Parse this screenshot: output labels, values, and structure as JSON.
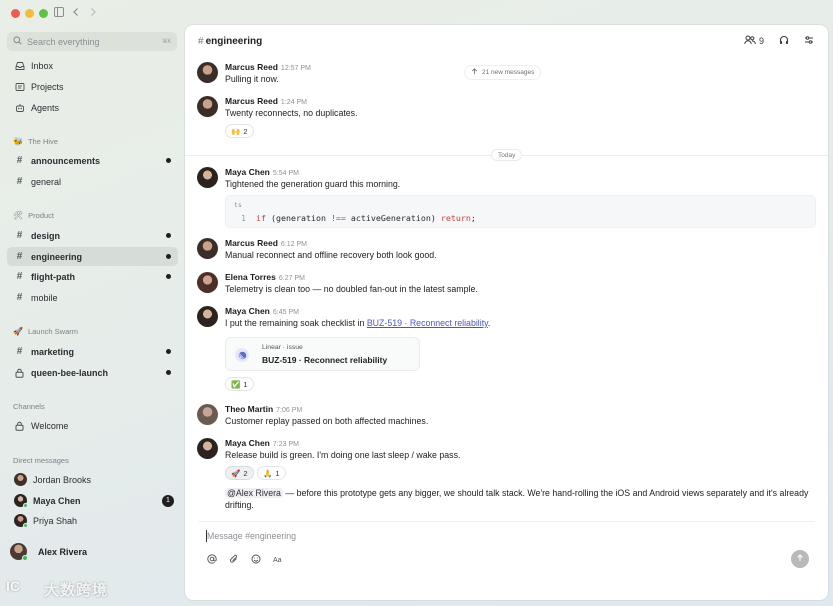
{
  "sidebar": {
    "search_placeholder": "Search everything",
    "search_shortcut": "⌘K",
    "top_items": [
      {
        "label": "Inbox",
        "icon": "inbox-icon"
      },
      {
        "label": "Projects",
        "icon": "projects-icon"
      },
      {
        "label": "Agents",
        "icon": "agents-icon"
      }
    ],
    "sections": [
      {
        "title": "The Hive",
        "emoji": "🐝",
        "channels": [
          {
            "label": "announcements",
            "unread": true
          },
          {
            "label": "general",
            "unread": false
          }
        ]
      },
      {
        "title": "Product",
        "emoji": "🛠",
        "channels": [
          {
            "label": "design",
            "unread": true
          },
          {
            "label": "engineering",
            "unread": true,
            "active": true
          },
          {
            "label": "flight-path",
            "unread": true
          },
          {
            "label": "mobile",
            "unread": false
          }
        ]
      },
      {
        "title": "Launch Swarm",
        "emoji": "🚀",
        "channels": [
          {
            "label": "marketing",
            "unread": true
          },
          {
            "label": "queen-bee-launch",
            "unread": true,
            "locked": true
          }
        ]
      }
    ],
    "channels_title": "Channels",
    "welcome_label": "Welcome",
    "dm_title": "Direct messages",
    "dms": [
      {
        "name": "Jordan Brooks",
        "online": false,
        "unread_count": null
      },
      {
        "name": "Maya Chen",
        "online": true,
        "unread_count": "1"
      },
      {
        "name": "Priya Shah",
        "online": true,
        "unread_count": null
      }
    ],
    "current_user": {
      "name": "Alex Rivera"
    }
  },
  "watermark": "大数跨境",
  "channel": {
    "name": "engineering",
    "member_count": "9",
    "new_messages_label": "21 new messages",
    "day_divider": "Today"
  },
  "messages": [
    {
      "author": "Marcus Reed",
      "time": "12:57 PM",
      "text": "Pulling it now."
    },
    {
      "author": "Marcus Reed",
      "time": "1:24 PM",
      "text": "Twenty reconnects, no duplicates.",
      "reactions": [
        {
          "emoji": "🙌",
          "count": "2"
        }
      ]
    },
    {
      "author": "Maya Chen",
      "time": "5:54 PM",
      "text": "Tightened the generation guard this morning.",
      "code": {
        "lang": "ts",
        "line_no": "1",
        "kw_if": "if",
        "cond_open": " (generation ",
        "op": "!==",
        "cond_close": " activeGeneration) ",
        "kw_return": "return",
        "end": ";"
      }
    },
    {
      "author": "Marcus Reed",
      "time": "6:12 PM",
      "text": "Manual reconnect and offline recovery both look good."
    },
    {
      "author": "Elena Torres",
      "time": "6:27 PM",
      "text": "Telemetry is clean too — no doubled fan-out in the latest sample."
    },
    {
      "author": "Maya Chen",
      "time": "6:45 PM",
      "text_prefix": "I put the remaining soak checklist in ",
      "link": "BUZ-519 · Reconnect reliability",
      "text_suffix": ".",
      "card": {
        "source": "Linear · issue",
        "title": "BUZ-519 · Reconnect reliability"
      },
      "reactions": [
        {
          "emoji": "✅",
          "count": "1"
        }
      ]
    },
    {
      "author": "Theo Martin",
      "time": "7:06 PM",
      "text": "Customer replay passed on both affected machines."
    },
    {
      "author": "Maya Chen",
      "time": "7:23 PM",
      "text": "Release build is green. I'm doing one last sleep / wake pass.",
      "reactions": [
        {
          "emoji": "🚀",
          "count": "2",
          "mine": true
        },
        {
          "emoji": "🙏",
          "count": "1"
        }
      ],
      "followup_mention": "@Alex Rivera",
      "followup_text": " — before this prototype gets any bigger, we should talk stack. We're hand-rolling the iOS and Android views separately and it's already drifting."
    }
  ],
  "composer": {
    "placeholder": "Message #engineering",
    "format_label": "Aa"
  },
  "colors": {
    "accent_link": "#4b59b5",
    "online": "#3ebd5c",
    "code_keyword": "#c2413f"
  }
}
